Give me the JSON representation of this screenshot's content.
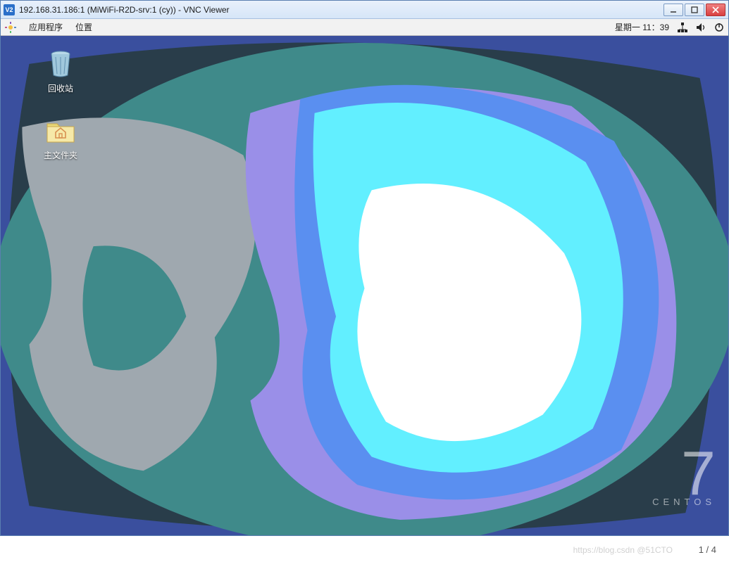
{
  "window": {
    "title": "192.168.31.186:1 (MiWiFi-R2D-srv:1 (cy)) - VNC Viewer",
    "app_badge": "V2"
  },
  "gnome_panel": {
    "apps_label": "应用程序",
    "places_label": "位置",
    "clock": "星期一 11：39"
  },
  "desktop": {
    "trash_label": "回收站",
    "home_label": "主文件夹"
  },
  "centos": {
    "version": "7",
    "name": "CENTOS"
  },
  "footer": {
    "page_indicator": "1 / 4",
    "watermark": "https://blog.csdn @51CTO"
  }
}
